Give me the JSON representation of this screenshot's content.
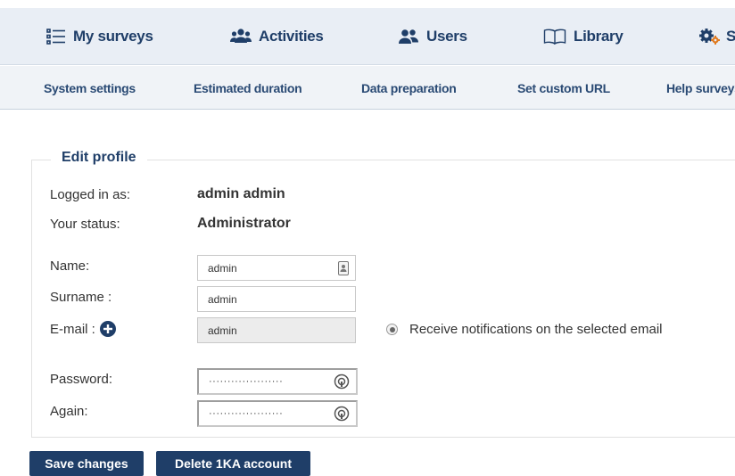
{
  "nav": {
    "items": [
      {
        "label": "My surveys",
        "icon": "list-icon"
      },
      {
        "label": "Activities",
        "icon": "users-group-icon"
      },
      {
        "label": "Users",
        "icon": "users-icon"
      },
      {
        "label": "Library",
        "icon": "book-icon"
      },
      {
        "label": "S",
        "icon": "gears-icon"
      }
    ]
  },
  "subnav": {
    "items": [
      "System settings",
      "Estimated duration",
      "Data preparation",
      "Set custom URL",
      "Help surveys"
    ]
  },
  "profile": {
    "legend": "Edit profile",
    "logged_in_label": "Logged in as:",
    "logged_in_value": "admin admin",
    "status_label": "Your status:",
    "status_value": "Administrator",
    "name_label": "Name:",
    "name_value": "admin",
    "surname_label": "Surname :",
    "surname_value": "admin",
    "email_label": "E-mail :",
    "email_value": "admin",
    "notify_label": "Receive notifications on the selected email",
    "password_label": "Password:",
    "password_value": "····················",
    "again_label": "Again:",
    "again_value": "····················"
  },
  "actions": {
    "save": "Save changes",
    "delete": "Delete 1KA account"
  },
  "colors": {
    "nav_bg": "#e9eef5",
    "subnav_bg": "#f0f3f7",
    "accent": "#1f3e68",
    "gear_accent": "#e07a1f"
  }
}
